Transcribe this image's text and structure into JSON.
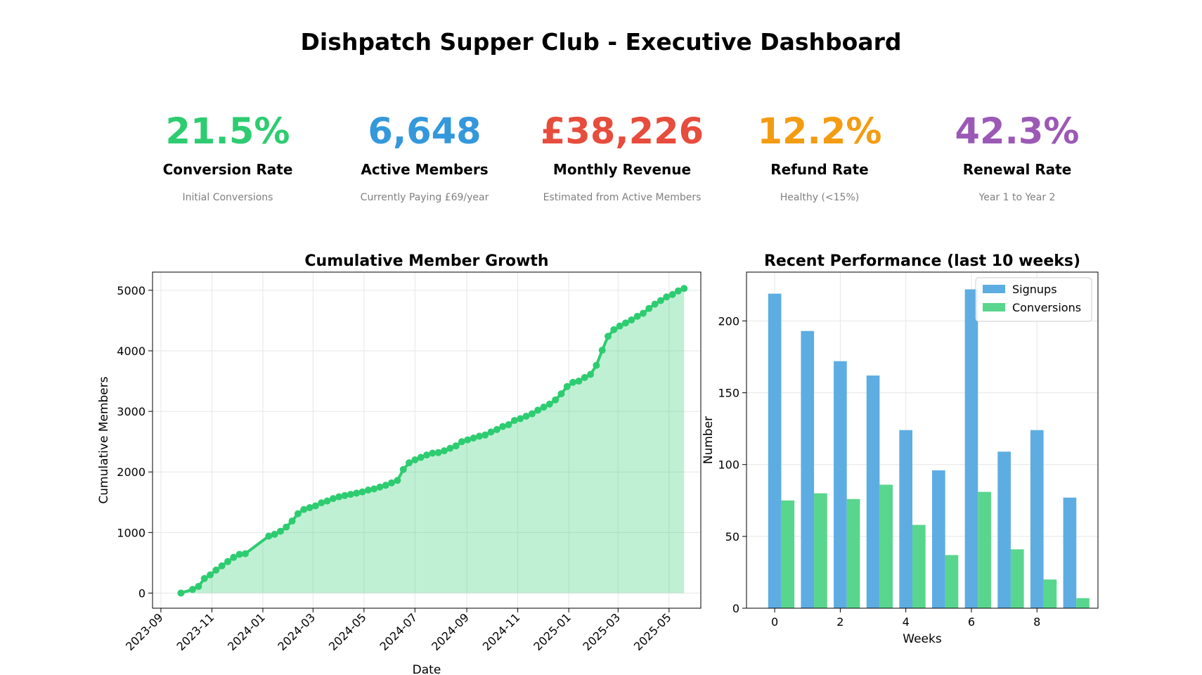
{
  "title": "Dishpatch Supper Club - Executive Dashboard",
  "kpis": [
    {
      "value": "21.5%",
      "label": "Conversion Rate",
      "sub": "Initial Conversions",
      "color": "#2ecc71"
    },
    {
      "value": "6,648",
      "label": "Active Members",
      "sub": "Currently Paying £69/year",
      "color": "#3498db"
    },
    {
      "value": "£38,226",
      "label": "Monthly Revenue",
      "sub": "Estimated from Active Members",
      "color": "#e74c3c"
    },
    {
      "value": "12.2%",
      "label": "Refund Rate",
      "sub": "Healthy (<15%)",
      "color": "#f39c12"
    },
    {
      "value": "42.3%",
      "label": "Renewal Rate",
      "sub": "Year 1 to Year 2",
      "color": "#9b59b6"
    }
  ],
  "chart_data": [
    {
      "type": "area",
      "title": "Cumulative Member Growth",
      "xlabel": "Date",
      "ylabel": "Cumulative Members",
      "color": "#2ecc71",
      "fill_color": "#2ecc71",
      "grid": true,
      "x_ticks": [
        "2023-09",
        "2023-11",
        "2024-01",
        "2024-03",
        "2024-05",
        "2024-07",
        "2024-09",
        "2024-11",
        "2025-01",
        "2025-03",
        "2025-05"
      ],
      "y_ticks": [
        0,
        1000,
        2000,
        3000,
        4000,
        5000
      ],
      "xlim": [
        "2023-08-22",
        "2025-06-08"
      ],
      "ylim": [
        -250,
        5300
      ],
      "x": [
        "2023-09-25",
        "2023-10-09",
        "2023-10-16",
        "2023-10-23",
        "2023-10-30",
        "2023-11-06",
        "2023-11-13",
        "2023-11-20",
        "2023-11-27",
        "2023-12-04",
        "2023-12-11",
        "2024-01-08",
        "2024-01-15",
        "2024-01-22",
        "2024-01-29",
        "2024-02-05",
        "2024-02-12",
        "2024-02-19",
        "2024-02-26",
        "2024-03-04",
        "2024-03-11",
        "2024-03-18",
        "2024-03-25",
        "2024-04-01",
        "2024-04-08",
        "2024-04-15",
        "2024-04-22",
        "2024-04-29",
        "2024-05-06",
        "2024-05-13",
        "2024-05-20",
        "2024-05-27",
        "2024-06-03",
        "2024-06-10",
        "2024-06-17",
        "2024-06-24",
        "2024-07-01",
        "2024-07-08",
        "2024-07-15",
        "2024-07-22",
        "2024-07-29",
        "2024-08-05",
        "2024-08-12",
        "2024-08-19",
        "2024-08-26",
        "2024-09-02",
        "2024-09-09",
        "2024-09-16",
        "2024-09-23",
        "2024-09-30",
        "2024-10-07",
        "2024-10-14",
        "2024-10-21",
        "2024-10-28",
        "2024-11-04",
        "2024-11-11",
        "2024-11-18",
        "2024-11-25",
        "2024-12-02",
        "2024-12-09",
        "2024-12-16",
        "2024-12-23",
        "2024-12-30",
        "2025-01-06",
        "2025-01-13",
        "2025-01-20",
        "2025-01-27",
        "2025-02-03",
        "2025-02-10",
        "2025-02-17",
        "2025-02-24",
        "2025-03-03",
        "2025-03-10",
        "2025-03-17",
        "2025-03-24",
        "2025-03-31",
        "2025-04-07",
        "2025-04-14",
        "2025-04-21",
        "2025-04-28",
        "2025-05-05",
        "2025-05-12",
        "2025-05-19"
      ],
      "y": [
        0,
        60,
        110,
        240,
        300,
        380,
        450,
        520,
        590,
        640,
        650,
        940,
        970,
        1020,
        1090,
        1190,
        1310,
        1380,
        1410,
        1440,
        1490,
        1520,
        1560,
        1590,
        1610,
        1630,
        1650,
        1670,
        1700,
        1720,
        1750,
        1780,
        1820,
        1860,
        2040,
        2150,
        2200,
        2240,
        2280,
        2310,
        2320,
        2350,
        2390,
        2430,
        2500,
        2530,
        2560,
        2590,
        2610,
        2660,
        2700,
        2750,
        2780,
        2850,
        2880,
        2920,
        2960,
        3020,
        3070,
        3120,
        3190,
        3290,
        3410,
        3480,
        3500,
        3560,
        3610,
        3760,
        4010,
        4240,
        4350,
        4410,
        4460,
        4510,
        4570,
        4620,
        4700,
        4770,
        4830,
        4890,
        4930,
        4990,
        5030
      ]
    },
    {
      "type": "bar",
      "title": "Recent Performance (last 10 weeks)",
      "xlabel": "Weeks",
      "ylabel": "Number",
      "grid": true,
      "legend": "top-right",
      "categories": [
        0,
        1,
        2,
        3,
        4,
        5,
        6,
        7,
        8,
        9
      ],
      "x_ticks": [
        0,
        2,
        4,
        6,
        8
      ],
      "y_ticks": [
        0,
        50,
        100,
        150,
        200
      ],
      "xlim": [
        -0.86,
        9.86
      ],
      "ylim": [
        0,
        234
      ],
      "series": [
        {
          "name": "Signups",
          "color": "#5dade2",
          "values": [
            219,
            193,
            172,
            162,
            124,
            96,
            222,
            109,
            124,
            77
          ]
        },
        {
          "name": "Conversions",
          "color": "#58d68d",
          "values": [
            75,
            80,
            76,
            86,
            58,
            37,
            81,
            41,
            20,
            7
          ]
        }
      ]
    }
  ]
}
